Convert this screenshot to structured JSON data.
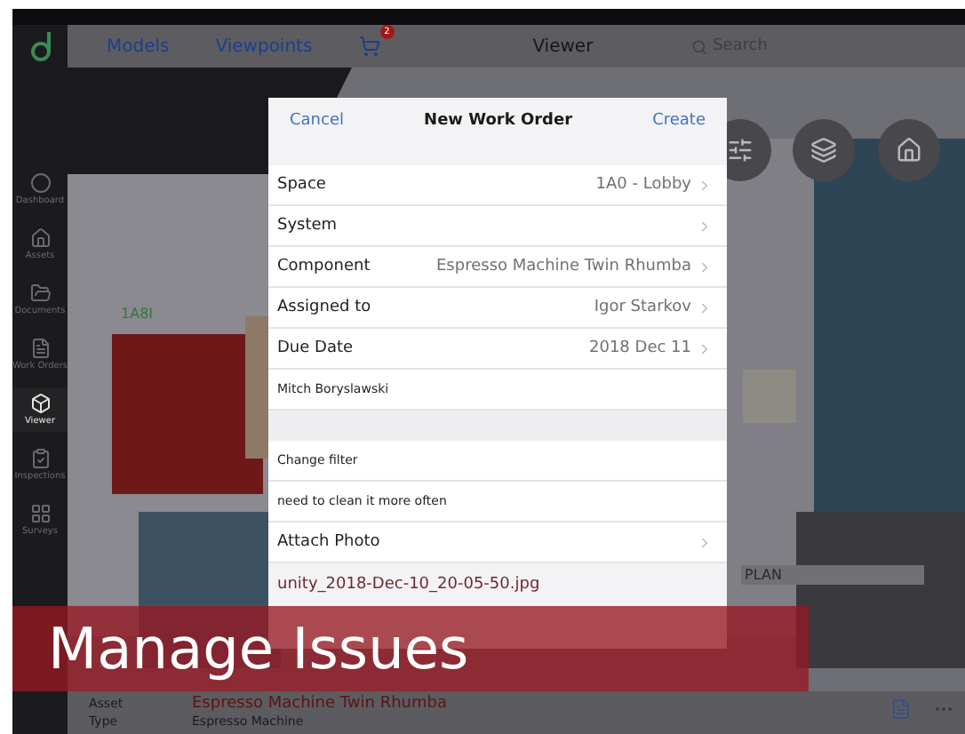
{
  "sidebar": {
    "items": [
      {
        "label": "Dashboard",
        "selected": false
      },
      {
        "label": "Assets",
        "selected": false
      },
      {
        "label": "Documents",
        "selected": false
      },
      {
        "label": "Work Orders",
        "selected": false
      },
      {
        "label": "Viewer",
        "selected": true
      },
      {
        "label": "Inspections",
        "selected": false
      },
      {
        "label": "Surveys",
        "selected": false
      }
    ]
  },
  "top_bar": {
    "tabs": [
      "Models",
      "Viewpoints"
    ],
    "cart_badge": "2",
    "title": "Viewer",
    "search": {
      "placeholder": "Search"
    }
  },
  "viewer": {
    "labels": [
      "1A8I",
      "PLAN"
    ]
  },
  "dialog": {
    "cancel": "Cancel",
    "title": "New Work Order",
    "create": "Create",
    "rows": [
      {
        "kind": "detail",
        "label": "Space",
        "value": "1A0 - Lobby"
      },
      {
        "kind": "detail",
        "label": "System"
      },
      {
        "kind": "detail",
        "label": "Component",
        "value": "Espresso Machine Twin Rhumba"
      },
      {
        "kind": "detail",
        "label": "Assigned to",
        "value": "Igor Starkov"
      },
      {
        "kind": "detail",
        "label": "Due Date",
        "value": "2018 Dec 11"
      },
      {
        "kind": "note",
        "label": "Mitch Boryslawski"
      },
      {
        "kind": "gap"
      },
      {
        "kind": "note",
        "label": "Change filter"
      },
      {
        "kind": "note",
        "label": "need to clean it more often"
      },
      {
        "kind": "detail",
        "label": "Attach Photo"
      },
      {
        "kind": "file",
        "label": "unity_2018-Dec-10_20-05-50.jpg"
      }
    ]
  },
  "asset_panel": {
    "rows": [
      {
        "label": "Asset",
        "value": "Espresso Machine Twin Rhumba"
      },
      {
        "label": "Type",
        "value": "Espresso Machine"
      }
    ]
  },
  "banner": {
    "title": "Manage Issues"
  }
}
